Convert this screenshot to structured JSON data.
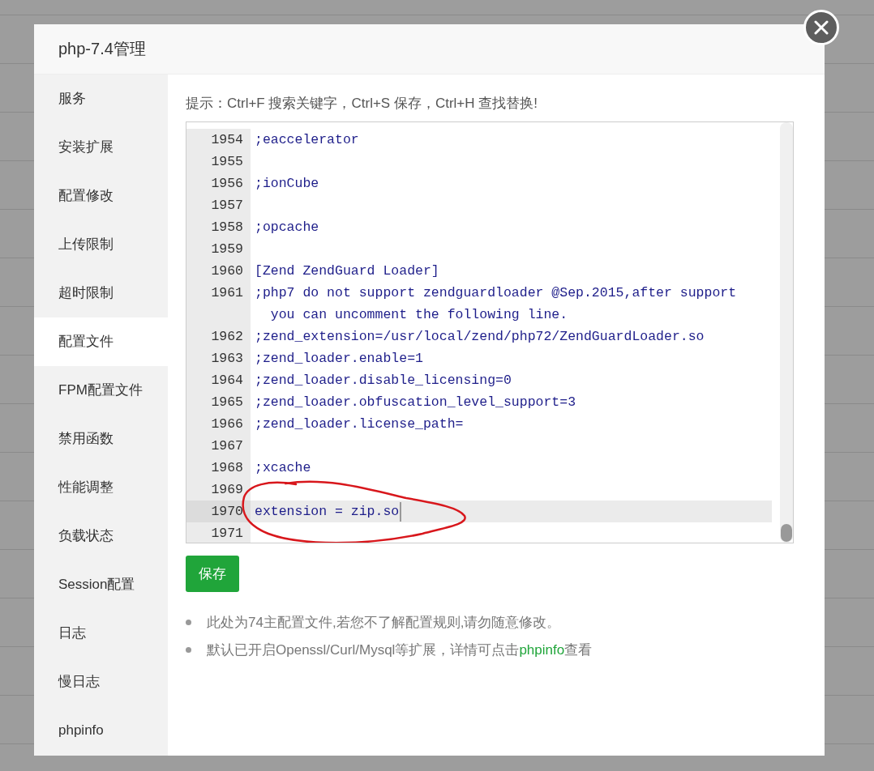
{
  "dialog": {
    "title": "php-7.4管理"
  },
  "sidebar": {
    "items": [
      {
        "label": "服务",
        "selected": false
      },
      {
        "label": "安装扩展",
        "selected": false
      },
      {
        "label": "配置修改",
        "selected": false
      },
      {
        "label": "上传限制",
        "selected": false
      },
      {
        "label": "超时限制",
        "selected": false
      },
      {
        "label": "配置文件",
        "selected": true
      },
      {
        "label": "FPM配置文件",
        "selected": false
      },
      {
        "label": "禁用函数",
        "selected": false
      },
      {
        "label": "性能调整",
        "selected": false
      },
      {
        "label": "负载状态",
        "selected": false
      },
      {
        "label": "Session配置",
        "selected": false
      },
      {
        "label": "日志",
        "selected": false
      },
      {
        "label": "慢日志",
        "selected": false
      },
      {
        "label": "phpinfo",
        "selected": false
      }
    ]
  },
  "hint": "提示：Ctrl+F 搜索关键字，Ctrl+S 保存，Ctrl+H 查找替换!",
  "editor": {
    "lines": [
      {
        "number": "1954",
        "text": ";eaccelerator",
        "active": false
      },
      {
        "number": "1955",
        "active": false
      },
      {
        "number": "1956",
        "text": ";ionCube",
        "active": false
      },
      {
        "number": "1957",
        "active": false
      },
      {
        "number": "1958",
        "text": ";opcache",
        "active": false
      },
      {
        "number": "1959",
        "active": false
      },
      {
        "number": "1960",
        "text": "[Zend ZendGuard Loader]",
        "active": false
      },
      {
        "number": "1961",
        "text": ";php7 do not support zendguardloader @Sep.2015,after support you can uncomment the following line.",
        "active": false
      },
      {
        "number": "1962",
        "text": ";zend_extension=/usr/local/zend/php72/ZendGuardLoader.so",
        "active": false
      },
      {
        "number": "1963",
        "text": ";zend_loader.enable=1",
        "active": false
      },
      {
        "number": "1964",
        "text": ";zend_loader.disable_licensing=0",
        "active": false
      },
      {
        "number": "1965",
        "text": ";zend_loader.obfuscation_level_support=3",
        "active": false
      },
      {
        "number": "1966",
        "text": ";zend_loader.license_path=",
        "active": false
      },
      {
        "number": "1967",
        "active": false
      },
      {
        "number": "1968",
        "text": ";xcache",
        "active": false
      },
      {
        "number": "1969",
        "active": false
      },
      {
        "number": "1970",
        "text": "extension = zip.so",
        "active": true
      },
      {
        "number": "1971",
        "active": false
      }
    ]
  },
  "save_button": "保存",
  "notes": [
    {
      "text": "此处为74主配置文件,若您不了解配置规则,请勿随意修改。"
    },
    {
      "text": "默认已开启Openssl/Curl/Mysql等扩展，详情可点击",
      "link": "phpinfo",
      "after": "查看"
    }
  ]
}
